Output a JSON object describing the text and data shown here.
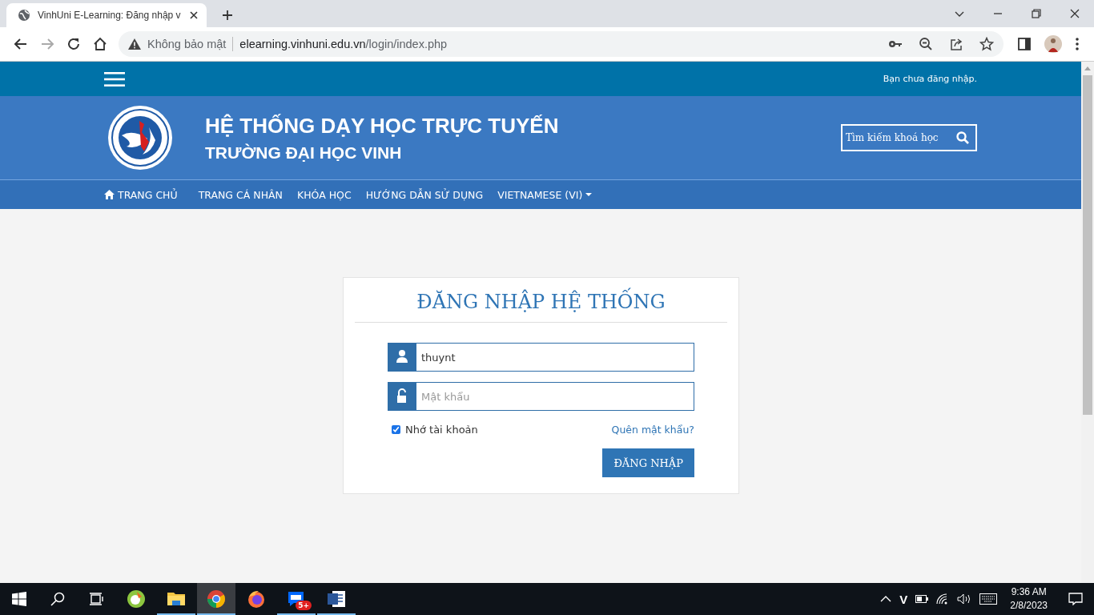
{
  "browser": {
    "tab_title": "VinhUni E-Learning: Đăng nhập v",
    "security_label": "Không bảo mật",
    "url_host": "elearning.vinhuni.edu.vn",
    "url_path": "/login/index.php"
  },
  "top_bar": {
    "login_status": "Bạn chưa đăng nhập."
  },
  "header": {
    "title": "HỆ THỐNG DẠY HỌC TRỰC TUYẾN",
    "subtitle": "TRƯỜNG ĐẠI HỌC VINH",
    "search": {
      "placeholder": "Tìm kiếm khoá học"
    }
  },
  "nav": [
    {
      "label": "TRANG CHỦ",
      "kind": "home"
    },
    {
      "label": "TRANG CÁ NHÂN",
      "kind": "link"
    },
    {
      "label": "KHÓA HỌC",
      "kind": "link"
    },
    {
      "label": "HƯỚNG DẪN SỬ DỤNG",
      "kind": "link"
    },
    {
      "label": "VIETNAMESE (VI)",
      "kind": "dropdown"
    }
  ],
  "login": {
    "heading": "ĐĂNG NHẬP HỆ THỐNG",
    "username": {
      "value": "thuynt"
    },
    "password": {
      "placeholder": "Mật khẩu"
    },
    "remember": {
      "label": "Nhớ tài khoản",
      "checked": true
    },
    "forgot_link": "Quên mật khẩu?",
    "submit": "ĐĂNG NHẬP"
  },
  "taskbar": {
    "apps": [
      {
        "kind": "coccoc",
        "running": false,
        "selected": false
      },
      {
        "kind": "files",
        "running": true,
        "selected": false
      },
      {
        "kind": "chrome",
        "running": true,
        "selected": true
      },
      {
        "kind": "firefox",
        "running": false,
        "selected": false
      },
      {
        "kind": "zalo",
        "running": true,
        "selected": false,
        "badge": "5+"
      },
      {
        "kind": "word",
        "running": true,
        "selected": false
      }
    ],
    "ime": "V",
    "time": "9:36 AM",
    "date": "2/8/2023"
  }
}
